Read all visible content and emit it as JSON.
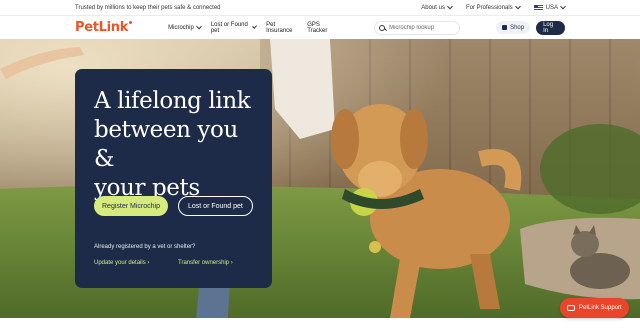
{
  "topbar": {
    "tagline": "Trusted by millions to keep their pets safe & connected",
    "about": "About us",
    "professionals": "For Professionals",
    "locale": "USA"
  },
  "nav": {
    "logo": "PetLink",
    "links": [
      "Microchip",
      "Lost or Found pet",
      "Pet Insurance",
      "GPS Tracker"
    ],
    "search_placeholder": "Microchip lookup",
    "shop": "Shop",
    "login": "Log In"
  },
  "hero": {
    "headline": "A lifelong link\nbetween you &\nyour pets",
    "primary_cta": "Register Microchip",
    "secondary_cta": "Lost or Found pet",
    "registered_prompt": "Already registered by a vet or shelter?",
    "update_link": "Update your details ›",
    "transfer_link": "Transfer ownership ›"
  },
  "support": {
    "label": "PetLink Support"
  },
  "colors": {
    "brand": "#e8572a",
    "navy": "#1d2b49",
    "lime": "#d6ea7d",
    "support": "#e8452a"
  }
}
